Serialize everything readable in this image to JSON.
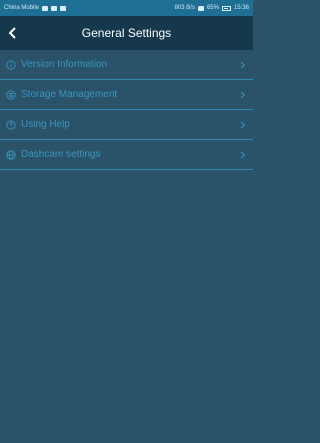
{
  "status_bar": {
    "carrier": "China Mobile",
    "speed": "803 B/s",
    "battery": "65%",
    "time": "15:36"
  },
  "header": {
    "title": "General Settings",
    "back_icon": "chevron-left-icon"
  },
  "menu": {
    "items": [
      {
        "label": "Version Information",
        "icon": "info-icon"
      },
      {
        "label": "Storage Management",
        "icon": "storage-icon"
      },
      {
        "label": "Using Help",
        "icon": "help-icon"
      },
      {
        "label": "Dashcam settings",
        "icon": "dashcam-icon"
      }
    ]
  },
  "colors": {
    "background": "#2a5268",
    "header": "#16384d",
    "status_bar": "#1f6f94",
    "accent": "#3a95c2",
    "divider": "#2c89b5"
  }
}
